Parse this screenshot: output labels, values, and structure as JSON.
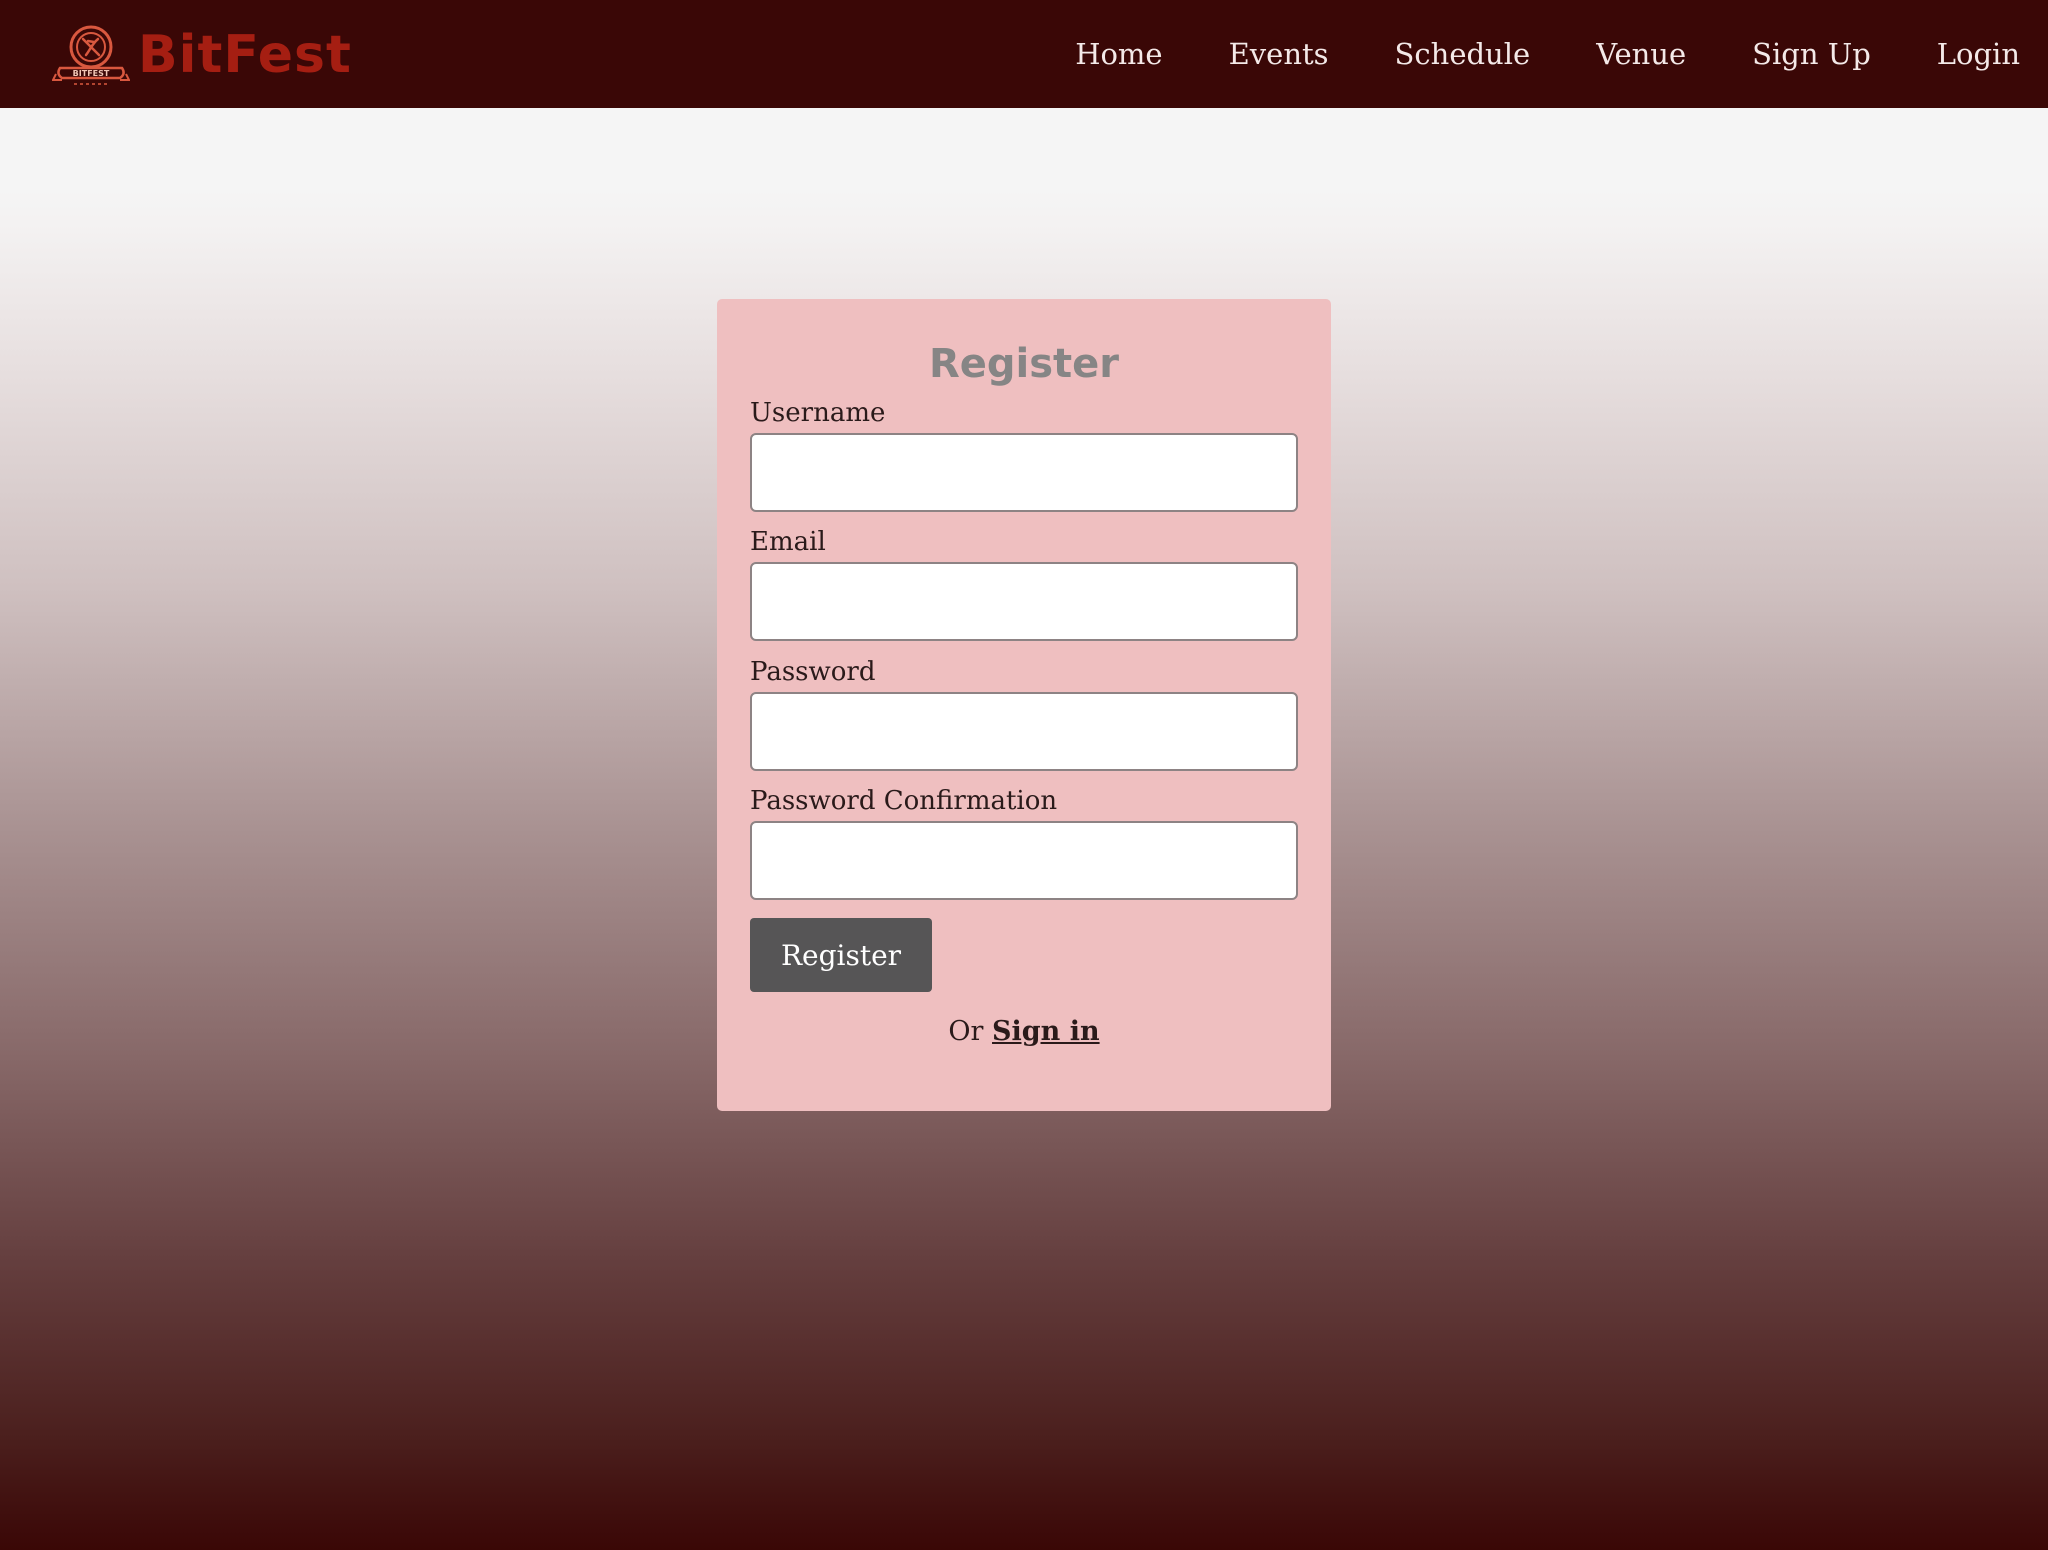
{
  "header": {
    "brand_name": "BitFest",
    "logo_text": "BITFEST",
    "logo_icon": "bitfest-logo-icon",
    "nav": [
      {
        "label": "Home"
      },
      {
        "label": "Events"
      },
      {
        "label": "Schedule"
      },
      {
        "label": "Venue"
      },
      {
        "label": "Sign Up"
      },
      {
        "label": "Login"
      }
    ]
  },
  "form": {
    "title": "Register",
    "fields": [
      {
        "label": "Username",
        "value": "",
        "placeholder": ""
      },
      {
        "label": "Email",
        "value": "",
        "placeholder": ""
      },
      {
        "label": "Password",
        "value": "",
        "placeholder": ""
      },
      {
        "label": "Password Confirmation",
        "value": "",
        "placeholder": ""
      }
    ],
    "submit_label": "Register",
    "alt_prefix": "Or",
    "alt_link_label": "Sign in"
  },
  "colors": {
    "navbar_bg": "#3a0706",
    "brand": "#a51e12",
    "card_bg": "#efbfc0",
    "button_bg": "#565556"
  }
}
